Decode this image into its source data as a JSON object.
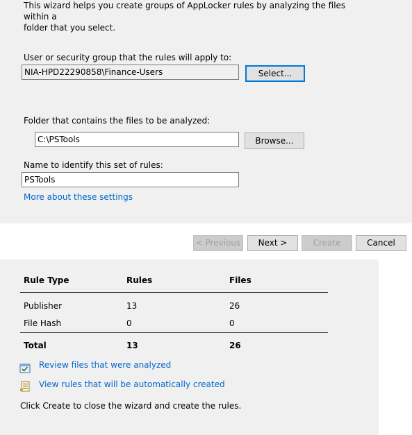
{
  "intro_text": "This wizard helps you create groups of AppLocker rules by analyzing the files within a\nfolder that you select.",
  "user_group": {
    "label": "User or security group that the rules will apply to:",
    "value": "NIA-HPD22290858\\Finance-Users",
    "select_button": "Select..."
  },
  "folder": {
    "label": "Folder that contains the files to be analyzed:",
    "value": "C:\\PSTools",
    "browse_button": "Browse..."
  },
  "rule_set_name": {
    "label": "Name to identify this set of rules:",
    "value": "PSTools"
  },
  "more_link": "More about these settings",
  "nav": {
    "previous": "< Previous",
    "next": "Next >",
    "create": "Create",
    "cancel": "Cancel"
  },
  "summary": {
    "headers": [
      "Rule Type",
      "Rules",
      "Files"
    ],
    "rows": [
      {
        "type": "Publisher",
        "rules": "13",
        "files": "26"
      },
      {
        "type": "File Hash",
        "rules": "0",
        "files": "0"
      }
    ],
    "total": {
      "type": "Total",
      "rules": "13",
      "files": "26"
    }
  },
  "review_link": "Review files that were analyzed",
  "view_link": "View rules that will be automatically created",
  "footer_text": "Click Create to close the wizard and create the rules."
}
